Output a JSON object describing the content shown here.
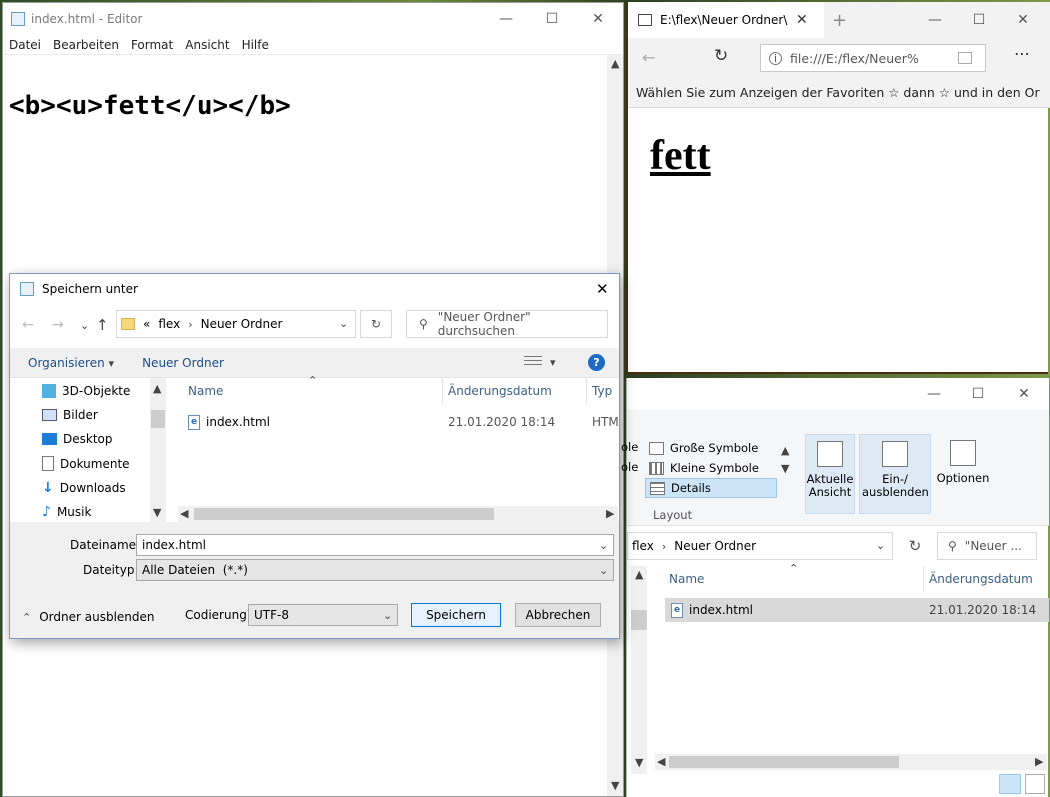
{
  "notepad": {
    "title": "index.html - Editor",
    "menu": [
      "Datei",
      "Bearbeiten",
      "Format",
      "Ansicht",
      "Hilfe"
    ],
    "content": "<b><u>fett</u></b>"
  },
  "edge": {
    "tab_title": "E:\\flex\\Neuer Ordner\\i",
    "address": "file:///E:/flex/Neuer%",
    "favorites_hint": "Wählen Sie zum Anzeigen der Favoriten  ☆  dann ☆ und in den Or",
    "page_heading": "fett"
  },
  "explorer": {
    "ribbon": {
      "view_items": [
        "Große Symbole",
        "Kleine Symbole",
        "Details"
      ],
      "cut_left_a": "ole",
      "cut_left_b": "ole",
      "group_label": "Layout",
      "current_view": "Aktuelle Ansicht",
      "show_hide": "Ein-/ ausblenden",
      "options": "Optionen"
    },
    "path": [
      "flex",
      "Neuer Ordner"
    ],
    "search_placeholder": "\"Neuer ...",
    "columns": {
      "name": "Name",
      "date": "Änderungsdatum"
    },
    "file": {
      "name": "index.html",
      "date": "21.01.2020 18:14"
    }
  },
  "dialog": {
    "title": "Speichern unter",
    "path": [
      "flex",
      "Neuer Ordner"
    ],
    "path_overflow": "«",
    "search_placeholder": "\"Neuer Ordner\" durchsuchen",
    "organize": "Organisieren",
    "new_folder": "Neuer Ordner",
    "tree": [
      "3D-Objekte",
      "Bilder",
      "Desktop",
      "Dokumente",
      "Downloads",
      "Musik"
    ],
    "columns": {
      "name": "Name",
      "date": "Änderungsdatum",
      "type": "Typ"
    },
    "file": {
      "name": "index.html",
      "date": "21.01.2020 18:14",
      "type": "HTM"
    },
    "filename_label": "Dateiname:",
    "filename_value": "index.html",
    "filetype_label": "Dateityp:",
    "filetype_value": "Alle Dateien  (*.*)",
    "hide_folders": "Ordner ausblenden",
    "encoding_label": "Codierung:",
    "encoding_value": "UTF-8",
    "save": "Speichern",
    "cancel": "Abbrechen"
  }
}
